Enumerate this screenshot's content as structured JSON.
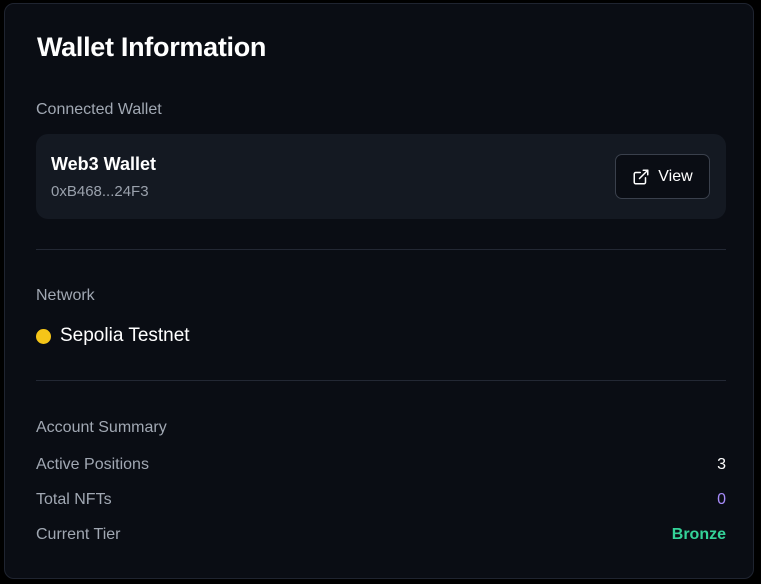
{
  "title": "Wallet Information",
  "connected_wallet": {
    "label": "Connected Wallet",
    "name": "Web3 Wallet",
    "address": "0xB468...24F3",
    "view_button": {
      "label": "View",
      "icon": "external-link-icon"
    }
  },
  "network": {
    "label": "Network",
    "name": "Sepolia Testnet",
    "status_color": "#f5c518"
  },
  "account_summary": {
    "label": "Account Summary",
    "rows": [
      {
        "label": "Active Positions",
        "value": "3",
        "color": "#ffffff"
      },
      {
        "label": "Total NFTs",
        "value": "0",
        "color": "#a78bfa"
      },
      {
        "label": "Current Tier",
        "value": "Bronze",
        "color": "#34d399"
      }
    ]
  }
}
